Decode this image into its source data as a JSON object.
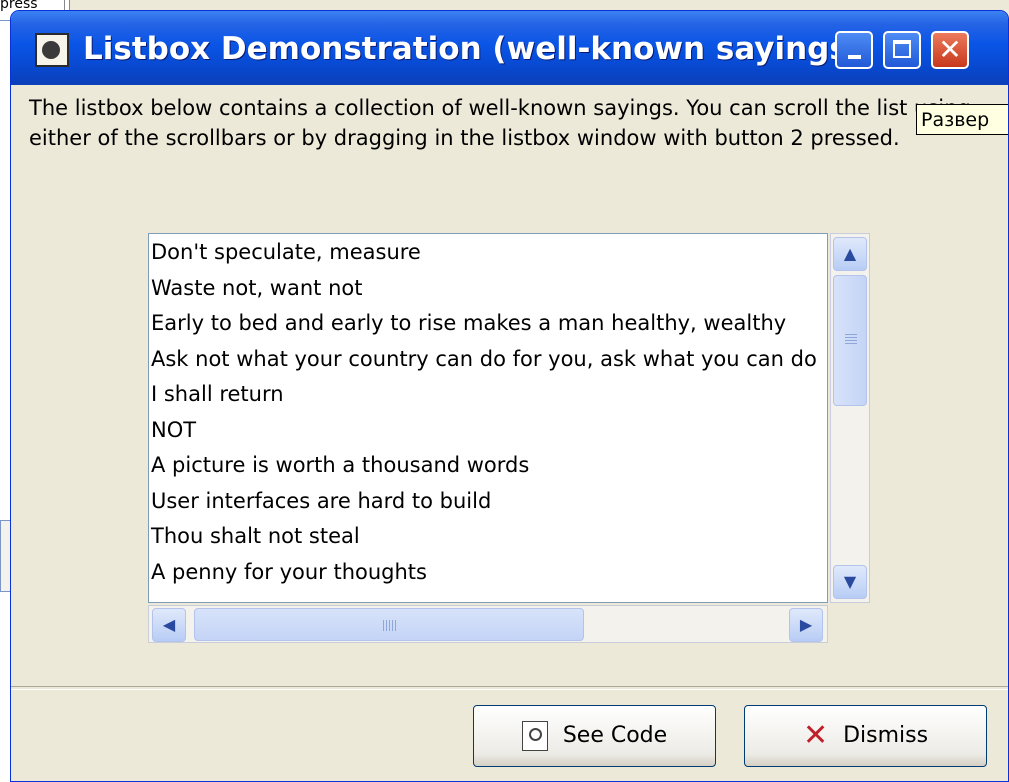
{
  "background_window": {
    "title_fragment": "press"
  },
  "window": {
    "title": "Listbox Demonstration (well-known sayings)",
    "controls": {
      "minimize": "_",
      "maximize": "□",
      "close": "✕"
    }
  },
  "description": "The listbox below contains a collection of well-known sayings.  You can scroll the list using either of the scrollbars or by dragging in the listbox window with button 2 pressed.",
  "tooltip": "Развер",
  "listbox": {
    "items": [
      "Don't speculate, measure",
      "Waste not, want not",
      "Early to bed and early to rise makes a man healthy, wealthy",
      "Ask not what your country can do for you, ask what you can do",
      "I shall return",
      "NOT",
      "A picture is worth a thousand words",
      "User interfaces are hard to build",
      "Thou shalt not steal",
      "A penny for your thoughts"
    ]
  },
  "buttons": {
    "see_code": "See Code",
    "dismiss": "Dismiss"
  },
  "icons": {
    "app": "feather-icon",
    "see_code": "magnifier-document-icon",
    "dismiss": "x-icon"
  }
}
